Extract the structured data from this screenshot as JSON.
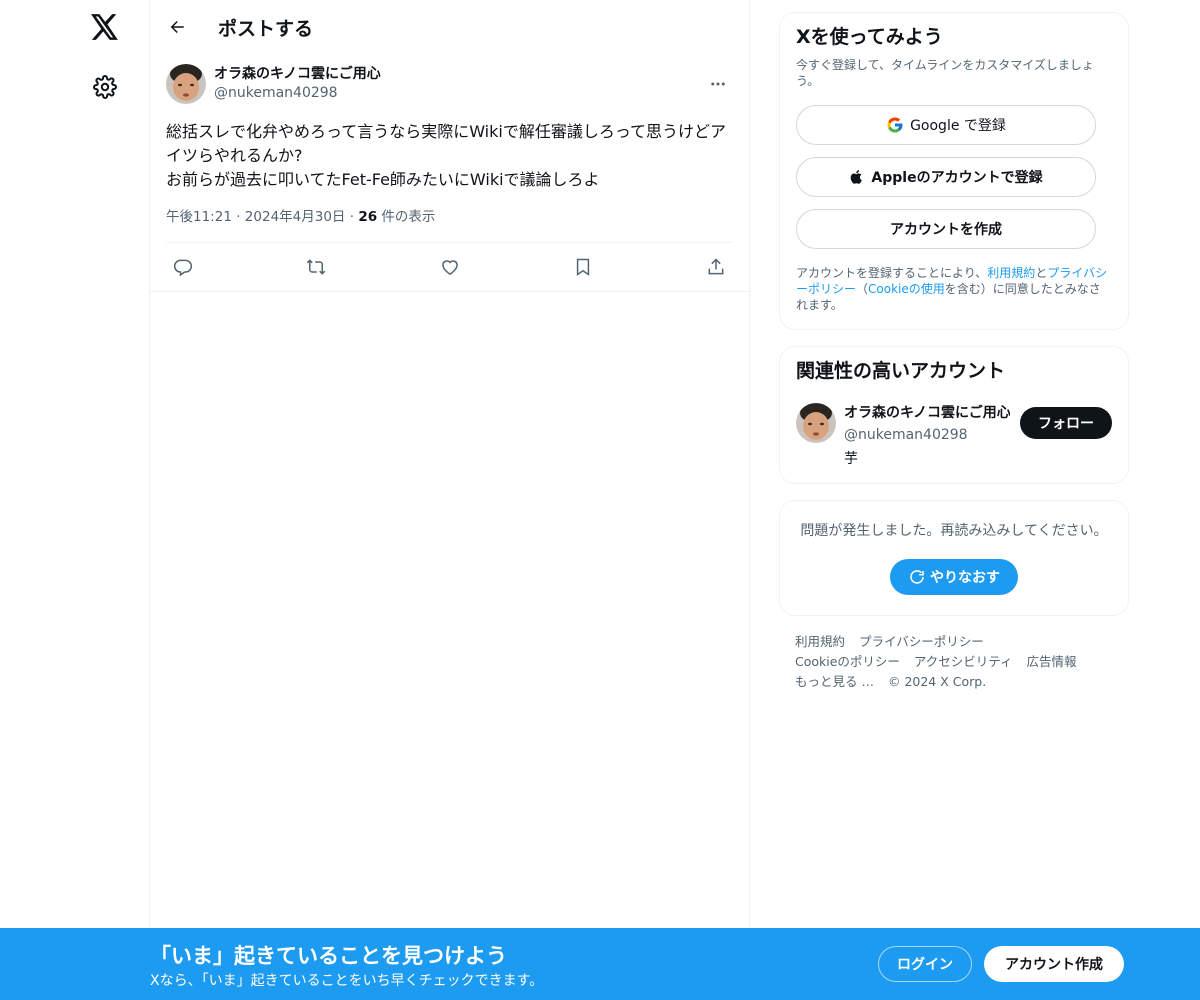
{
  "nav": {
    "logo_icon": "x-logo-icon",
    "settings_icon": "gear-icon"
  },
  "header": {
    "title": "ポストする",
    "back_icon": "arrow-left-icon"
  },
  "post": {
    "author_name": "オラ森のキノコ雲にご用心",
    "author_handle": "@nukeman40298",
    "text": "総括スレで化弁やめろって言うなら実際にWikiで解任審議しろって思うけどアイツらやれるんか?\nお前らが過去に叩いてたFet-Fe師みたいにWikiで議論しろよ",
    "time": "午後11:21",
    "date": "2024年4月30日",
    "views_count": "26",
    "views_label": "件の表示",
    "separator": "·",
    "actions": [
      "reply-icon",
      "repost-icon",
      "like-icon",
      "bookmark-icon",
      "share-icon"
    ]
  },
  "signup_card": {
    "title": "Xを使ってみよう",
    "subtitle": "今すぐ登録して、タイムラインをカスタマイズしましょう。",
    "google_label": "Google で登録",
    "apple_label": "Appleのアカウントで登録",
    "create_label": "アカウントを作成",
    "legal_pre": "アカウントを登録することにより、",
    "legal_terms": "利用規約",
    "legal_and": "と",
    "legal_privacy": "プライバシーポリシー",
    "legal_mid": "（",
    "legal_cookie": "Cookieの使用",
    "legal_post": "を含む）に同意したとみなされます。"
  },
  "related_card": {
    "title": "関連性の高いアカウント",
    "name": "オラ森のキノコ雲にご用心",
    "handle": "@nukeman40298",
    "bio": "芋",
    "follow_label": "フォロー"
  },
  "error_card": {
    "message": "問題が発生しました。再読み込みしてください。",
    "retry_label": "やりなおす"
  },
  "footer": {
    "terms": "利用規約",
    "privacy": "プライバシーポリシー",
    "cookie": "Cookieのポリシー",
    "accessibility": "アクセシビリティ",
    "ads": "広告情報",
    "more": "もっと見る …",
    "copyright": "© 2024 X Corp."
  },
  "bottom_bar": {
    "title": "「いま」起きていることを見つけよう",
    "subtitle": "Xなら、「いま」起きていることをいち早くチェックできます。",
    "login_label": "ログイン",
    "signup_label": "アカウント作成"
  },
  "colors": {
    "accent": "#1d9bf0",
    "text": "#0f1419",
    "muted": "#536471",
    "border": "#eff3f4"
  }
}
